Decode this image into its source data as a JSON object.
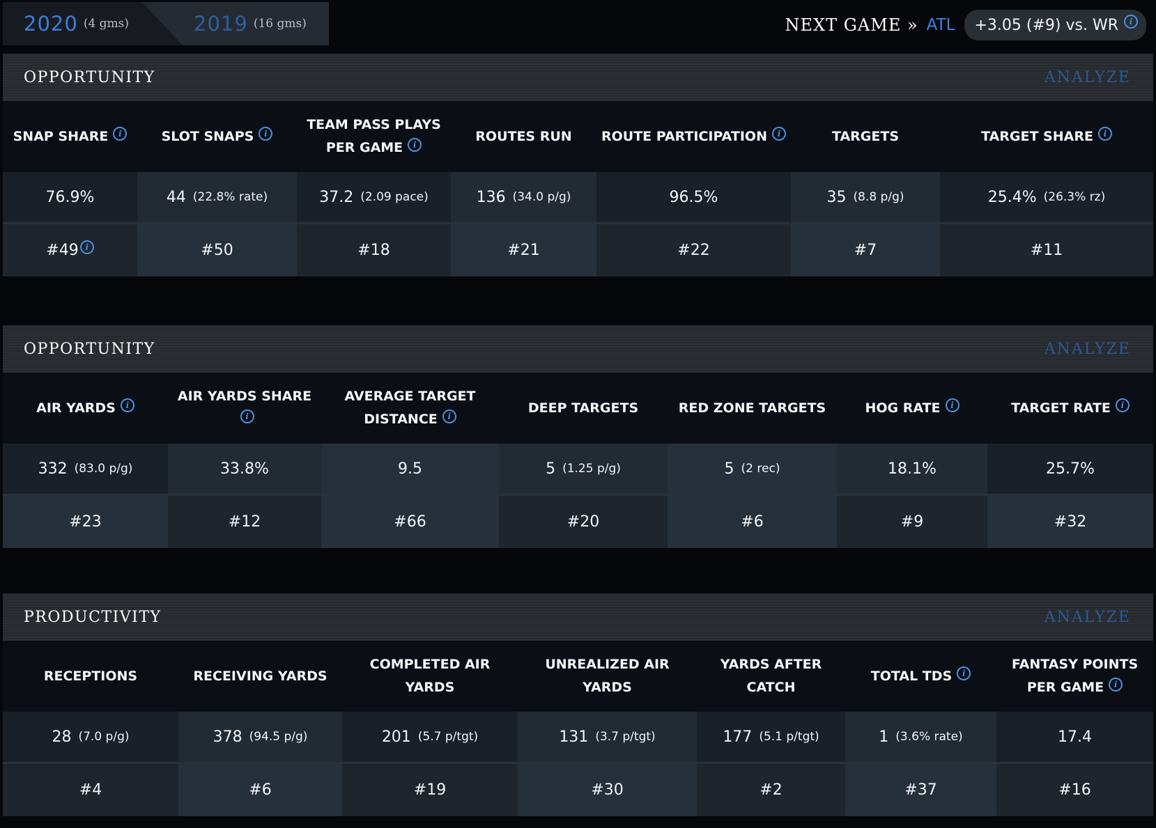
{
  "header": {
    "seasons": [
      {
        "year": "2020",
        "games": "(4 gms)"
      },
      {
        "year": "2019",
        "games": "(16 gms)"
      }
    ],
    "next_game_label": "NEXT GAME »",
    "next_game_team": "ATL",
    "matchup": "+3.05 (#9) vs. WR"
  },
  "sections": [
    {
      "title": "OPPORTUNITY",
      "analyze": "ANALYZE",
      "columns": [
        {
          "label": "SNAP SHARE",
          "value": "76.9%",
          "sub": "",
          "rank": "#49"
        },
        {
          "label": "SLOT SNAPS",
          "value": "44",
          "sub": "(22.8% rate)",
          "rank": "#50"
        },
        {
          "label": "TEAM PASS PLAYS PER GAME",
          "value": "37.2",
          "sub": "(2.09 pace)",
          "rank": "#18"
        },
        {
          "label": "ROUTES RUN",
          "value": "136",
          "sub": "(34.0 p/g)",
          "rank": "#21"
        },
        {
          "label": "ROUTE PARTICIPATION",
          "value": "96.5%",
          "sub": "",
          "rank": "#22"
        },
        {
          "label": "TARGETS",
          "value": "35",
          "sub": "(8.8 p/g)",
          "rank": "#7"
        },
        {
          "label": "TARGET SHARE",
          "value": "25.4%",
          "sub": "(26.3% rz)",
          "rank": "#11"
        }
      ]
    },
    {
      "title": "OPPORTUNITY",
      "analyze": "ANALYZE",
      "columns": [
        {
          "label": "AIR YARDS",
          "value": "332",
          "sub": "(83.0 p/g)",
          "rank": "#23"
        },
        {
          "label": "AIR YARDS SHARE",
          "value": "33.8%",
          "sub": "",
          "rank": "#12"
        },
        {
          "label": "AVERAGE TARGET DISTANCE",
          "value": "9.5",
          "sub": "",
          "rank": "#66"
        },
        {
          "label": "DEEP TARGETS",
          "value": "5",
          "sub": "(1.25 p/g)",
          "rank": "#20"
        },
        {
          "label": "RED ZONE TARGETS",
          "value": "5",
          "sub": "(2 rec)",
          "rank": "#6"
        },
        {
          "label": "HOG RATE",
          "value": "18.1%",
          "sub": "",
          "rank": "#9"
        },
        {
          "label": "TARGET RATE",
          "value": "25.7%",
          "sub": "",
          "rank": "#32"
        }
      ]
    },
    {
      "title": "PRODUCTIVITY",
      "analyze": "ANALYZE",
      "columns": [
        {
          "label": "RECEPTIONS",
          "value": "28",
          "sub": "(7.0 p/g)",
          "rank": "#4"
        },
        {
          "label": "RECEIVING YARDS",
          "value": "378",
          "sub": "(94.5 p/g)",
          "rank": "#6"
        },
        {
          "label": "COMPLETED AIR YARDS",
          "value": "201",
          "sub": "(5.7 p/tgt)",
          "rank": "#19"
        },
        {
          "label": "UNREALIZED AIR YARDS",
          "value": "131",
          "sub": "(3.7 p/tgt)",
          "rank": "#30"
        },
        {
          "label": "YARDS AFTER CATCH",
          "value": "177",
          "sub": "(5.1 p/tgt)",
          "rank": "#2"
        },
        {
          "label": "TOTAL TDS",
          "value": "1",
          "sub": "(3.6% rate)",
          "rank": "#37"
        },
        {
          "label": "FANTASY POINTS PER GAME",
          "value": "17.4",
          "sub": "",
          "rank": "#16"
        }
      ]
    }
  ]
}
